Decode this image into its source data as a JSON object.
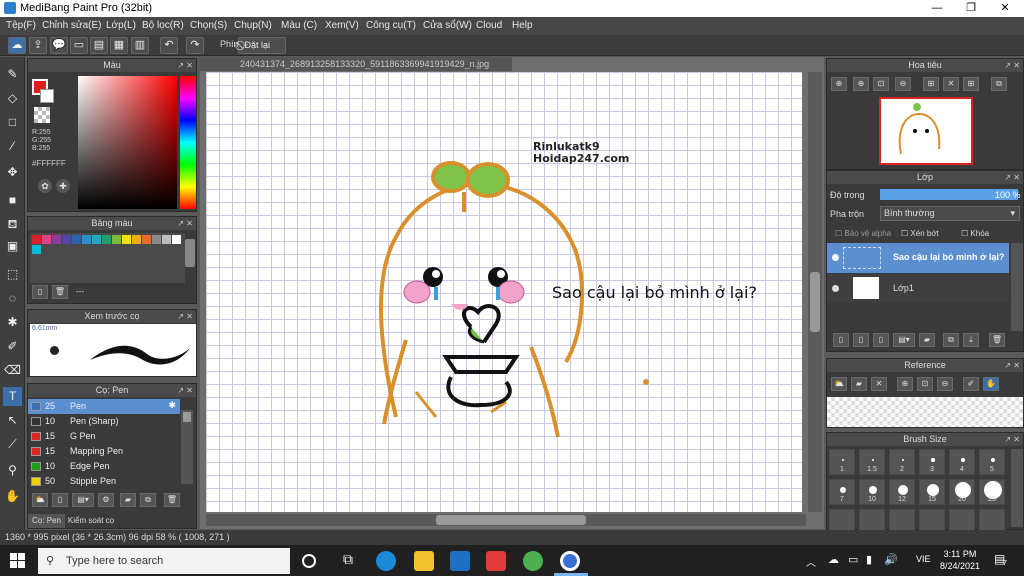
{
  "window": {
    "title": "MediBang Paint Pro (32bit)"
  },
  "menu": [
    "Tệp(F)",
    "Chỉnh sửa(E)",
    "Lớp(L)",
    "Bộ lọc(R)",
    "Chọn(S)",
    "Chụp(N)",
    "Màu (C)",
    "Xem(V)",
    "Công cụ(T)",
    "Cửa sổ(W)",
    "Cloud",
    "Help"
  ],
  "toolbar": {
    "key_label": "Phím",
    "reset_label": "Đặt lại"
  },
  "color_panel": {
    "title": "Màu",
    "r": "R:255",
    "g": "G:255",
    "b": "B:255",
    "hex": "#FFFFFF"
  },
  "palette_panel": {
    "title": "Bảng màu",
    "footer_text": "---",
    "swatches": [
      "#d9232a",
      "#e53f89",
      "#8d3ca0",
      "#5245a8",
      "#2c63b4",
      "#2c8fd0",
      "#21a9c2",
      "#22a06b",
      "#7cba3b",
      "#f3e20b",
      "#f6a91c",
      "#ec6a2b",
      "#8a8a8a",
      "#bdbdbd",
      "#ffffff",
      "#00bcd4"
    ]
  },
  "preview_panel": {
    "title": "Xem trước cọ",
    "size": "6.61mm"
  },
  "brush_panel": {
    "title": "Cọ: Pen",
    "brushes": [
      {
        "size": "25",
        "name": "Pen",
        "color": "#3b6fb6",
        "selected": true
      },
      {
        "size": "10",
        "name": "Pen (Sharp)",
        "color": "#333333"
      },
      {
        "size": "15",
        "name": "G Pen",
        "color": "#e02424"
      },
      {
        "size": "15",
        "name": "Mapping Pen",
        "color": "#e02424"
      },
      {
        "size": "10",
        "name": "Edge Pen",
        "color": "#1aa01a"
      },
      {
        "size": "50",
        "name": "Stipple Pen",
        "color": "#f0d000"
      }
    ],
    "tabs": [
      "Cọ: Pen",
      "Kiểm soát cọ"
    ]
  },
  "document": {
    "tab": "240431374_268913258133320_5911863369941919429_n.jpg",
    "watermark_line1": "Rinlukatk9",
    "watermark_line2": "Hoidap247.com",
    "speech": "Sao cậu lại bỏ mình ở lại?"
  },
  "navigator": {
    "title": "Hoa tiêu"
  },
  "layer_panel": {
    "title": "Lớp",
    "opacity_label": "Độ trong",
    "opacity_value": "100 %",
    "opacity": 1.0,
    "blend_label": "Pha trộn",
    "blend_value": "Bình thường",
    "protect_alpha": "Bảo vệ alpha",
    "clipping": "Xén bớt",
    "lock": "Khóa",
    "layers": [
      {
        "name": "Sao cậu lại bỏ mình ở lại?",
        "selected": true
      },
      {
        "name": "Lớp1",
        "selected": false
      }
    ]
  },
  "reference_panel": {
    "title": "Reference"
  },
  "brush_size_panel": {
    "title": "Brush Size",
    "sizes": [
      "1",
      "1.5",
      "2",
      "3",
      "4",
      "5",
      "7",
      "10",
      "12",
      "15",
      "20",
      "25"
    ]
  },
  "status": {
    "text": "1360 * 995 pixel   (36 * 26.3cm)   96 dpi   58 %   ( 1008, 271 )"
  },
  "taskbar": {
    "search_placeholder": "Type here to search",
    "lang": "VIE",
    "time": "3:11 PM",
    "date": "8/24/2021",
    "notifications": "7"
  }
}
